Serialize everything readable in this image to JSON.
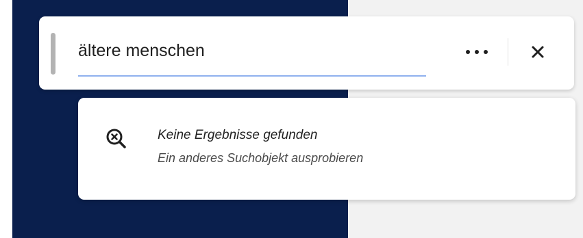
{
  "search": {
    "value": "ältere menschen",
    "more_icon": "ellipsis-horizontal-icon",
    "close_icon": "close-icon"
  },
  "results": {
    "icon": "search-no-results-icon",
    "title": "Keine Ergebnisse gefunden",
    "subtitle": "Ein anderes Suchobjekt ausprobieren"
  },
  "colors": {
    "background_dark": "#0a1f4d",
    "background_light": "#f2f2f2",
    "input_underline": "#8fb1ee",
    "text_primary": "#1f1f1f"
  }
}
